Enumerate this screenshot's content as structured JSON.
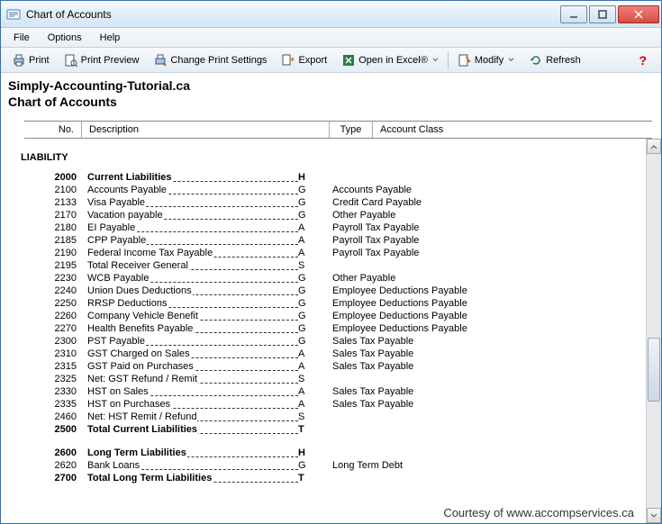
{
  "window": {
    "title": "Chart of Accounts"
  },
  "menubar": {
    "file": "File",
    "options": "Options",
    "help": "Help"
  },
  "toolbar": {
    "print": "Print",
    "preview": "Print Preview",
    "settings": "Change Print Settings",
    "export": "Export",
    "excel": "Open in Excel®",
    "modify": "Modify",
    "refresh": "Refresh",
    "help": "?"
  },
  "report": {
    "company": "Simply-Accounting-Tutorial.ca",
    "name": "Chart of Accounts"
  },
  "columns": {
    "no": "No.",
    "desc": "Description",
    "type": "Type",
    "class": "Account Class"
  },
  "section": "LIABILITY",
  "footer_text": "Courtesy of www.accompservices.ca",
  "accounts": [
    {
      "bold": true,
      "no": "2000",
      "desc": "Current Liabilities",
      "type": "H",
      "class": ""
    },
    {
      "bold": false,
      "no": "2100",
      "desc": "Accounts Payable",
      "type": "G",
      "class": "Accounts Payable"
    },
    {
      "bold": false,
      "no": "2133",
      "desc": "Visa Payable",
      "type": "G",
      "class": "Credit Card Payable"
    },
    {
      "bold": false,
      "no": "2170",
      "desc": "Vacation payable",
      "type": "G",
      "class": "Other Payable"
    },
    {
      "bold": false,
      "no": "2180",
      "desc": "EI Payable",
      "type": "A",
      "class": "Payroll Tax Payable"
    },
    {
      "bold": false,
      "no": "2185",
      "desc": "CPP Payable",
      "type": "A",
      "class": "Payroll Tax Payable"
    },
    {
      "bold": false,
      "no": "2190",
      "desc": "Federal Income Tax Payable",
      "type": "A",
      "class": "Payroll Tax Payable"
    },
    {
      "bold": false,
      "no": "2195",
      "desc": "Total Receiver General",
      "type": "S",
      "class": ""
    },
    {
      "bold": false,
      "no": "2230",
      "desc": "WCB Payable",
      "type": "G",
      "class": "Other Payable"
    },
    {
      "bold": false,
      "no": "2240",
      "desc": "Union Dues Deductions",
      "type": "G",
      "class": "Employee Deductions Payable"
    },
    {
      "bold": false,
      "no": "2250",
      "desc": "RRSP Deductions",
      "type": "G",
      "class": "Employee Deductions Payable"
    },
    {
      "bold": false,
      "no": "2260",
      "desc": "Company Vehicle Benefit",
      "type": "G",
      "class": "Employee Deductions Payable"
    },
    {
      "bold": false,
      "no": "2270",
      "desc": "Health Benefits Payable",
      "type": "G",
      "class": "Employee Deductions Payable"
    },
    {
      "bold": false,
      "no": "2300",
      "desc": "PST Payable",
      "type": "G",
      "class": "Sales Tax Payable"
    },
    {
      "bold": false,
      "no": "2310",
      "desc": "GST Charged on Sales",
      "type": "A",
      "class": "Sales Tax Payable"
    },
    {
      "bold": false,
      "no": "2315",
      "desc": "GST Paid on Purchases",
      "type": "A",
      "class": "Sales Tax Payable"
    },
    {
      "bold": false,
      "no": "2325",
      "desc": "Net: GST Refund / Remit",
      "type": "S",
      "class": ""
    },
    {
      "bold": false,
      "no": "2330",
      "desc": "HST on Sales",
      "type": "A",
      "class": "Sales Tax Payable"
    },
    {
      "bold": false,
      "no": "2335",
      "desc": "HST on Purchases",
      "type": "A",
      "class": "Sales Tax Payable"
    },
    {
      "bold": false,
      "no": "2460",
      "desc": "Net: HST Remit / Refund",
      "type": "S",
      "class": ""
    },
    {
      "bold": true,
      "no": "2500",
      "desc": "Total Current Liabilities",
      "type": "T",
      "class": ""
    },
    {
      "spacer": true
    },
    {
      "bold": true,
      "no": "2600",
      "desc": "Long Term Liabilities",
      "type": "H",
      "class": ""
    },
    {
      "bold": false,
      "no": "2620",
      "desc": "Bank Loans",
      "type": "G",
      "class": "Long Term Debt"
    },
    {
      "bold": true,
      "no": "2700",
      "desc": "Total Long Term Liabilities",
      "type": "T",
      "class": ""
    }
  ]
}
